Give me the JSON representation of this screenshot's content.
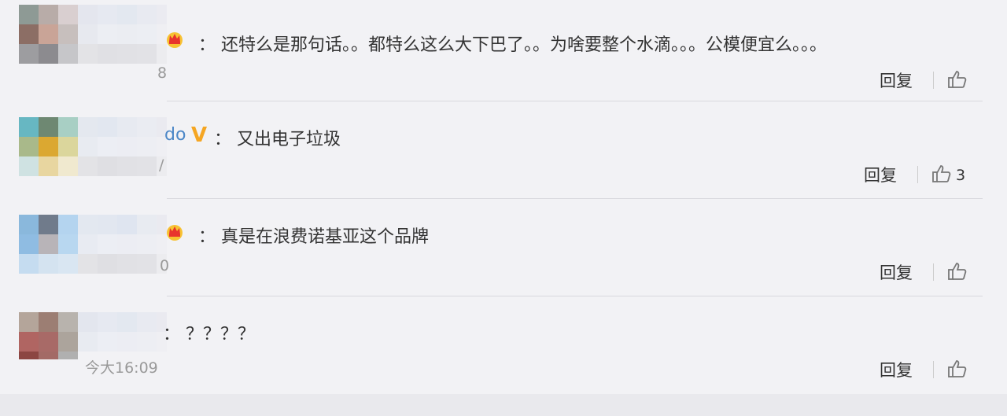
{
  "comments": [
    {
      "name_visible": "",
      "colon": "：",
      "text": "还特么是那句话。。都特么这么大下巴了。。为啥要整个水滴。。。公模便宜么。。。",
      "time": "8",
      "reply": "回复",
      "likes": "",
      "badge": "crown-icon"
    },
    {
      "name_visible": "do",
      "colon": "：",
      "text": "又出电子垃圾",
      "time": "/",
      "reply": "回复",
      "likes": "3",
      "badge": "verified-v-icon"
    },
    {
      "name_visible": "",
      "colon": "：",
      "text": "真是在浪费诺基亚这个品牌",
      "time": "0",
      "reply": "回复",
      "likes": "",
      "badge": "crown-icon"
    },
    {
      "name_visible": "",
      "colon": "：",
      "text": "？？？？",
      "time": "今大16:09",
      "reply": "回复",
      "likes": "",
      "badge": ""
    }
  ],
  "colors": {
    "background": "#f2f2f5",
    "name_blue": "#4c87c7",
    "verified_gold": "#f5a623",
    "text": "#333333",
    "muted": "#999999"
  }
}
